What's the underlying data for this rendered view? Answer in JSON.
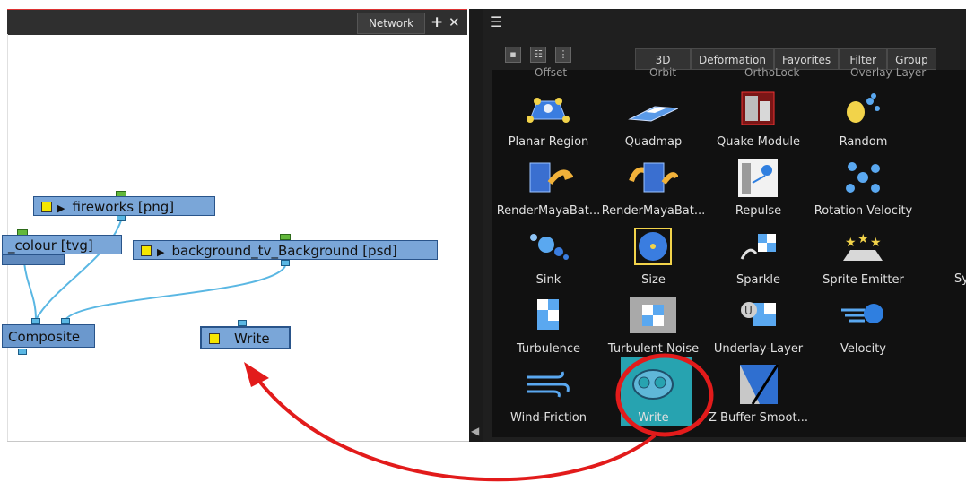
{
  "network_panel": {
    "tab_label": "Network",
    "add_symbol": "+",
    "close_symbol": "✕",
    "nodes": {
      "fireworks": "fireworks [png]",
      "colour": "_colour [tvg]",
      "background": "background_tv_Background [psd]",
      "composite": "Composite",
      "write": "Write"
    }
  },
  "library_panel": {
    "menu_icon": "menu-icon",
    "tabs": [
      "3D",
      "Deformation",
      "Favorites",
      "Filter",
      "Group"
    ],
    "top_cut_labels": [
      "Offset",
      "Orbit",
      "OrthoLock",
      "Overlay-Layer"
    ],
    "items": [
      {
        "label": "Planar Region",
        "icon": "planar-region-icon"
      },
      {
        "label": "Quadmap",
        "icon": "quadmap-icon"
      },
      {
        "label": "Quake Module",
        "icon": "quake-module-icon"
      },
      {
        "label": "Random",
        "icon": "random-icon"
      },
      {
        "label": "RenderMayaBat...",
        "icon": "render-maya-batch-icon"
      },
      {
        "label": "RenderMayaBat...",
        "icon": "render-maya-batch-icon"
      },
      {
        "label": "Repulse",
        "icon": "repulse-icon"
      },
      {
        "label": "Rotation Velocity",
        "icon": "rotation-velocity-icon"
      },
      {
        "label": "Sink",
        "icon": "sink-icon"
      },
      {
        "label": "Size",
        "icon": "size-icon"
      },
      {
        "label": "Sparkle",
        "icon": "sparkle-icon"
      },
      {
        "label": "Sprite Emitter",
        "icon": "sprite-emitter-icon"
      },
      {
        "label": "Turbulence",
        "icon": "turbulence-icon"
      },
      {
        "label": "Turbulent Noise",
        "icon": "turbulent-noise-icon"
      },
      {
        "label": "Underlay-Layer",
        "icon": "underlay-layer-icon"
      },
      {
        "label": "Velocity",
        "icon": "velocity-icon"
      },
      {
        "label": "Wind-Friction",
        "icon": "wind-friction-icon"
      },
      {
        "label": "Write",
        "icon": "write-icon"
      },
      {
        "label": "Z Buffer Smoot...",
        "icon": "z-buffer-smoothing-icon"
      }
    ],
    "cut_off_label": "Sy"
  },
  "colors": {
    "node_fill": "#7aa6d8",
    "annotation_red": "#e21b1b",
    "write_highlight": "#27a3b0"
  }
}
